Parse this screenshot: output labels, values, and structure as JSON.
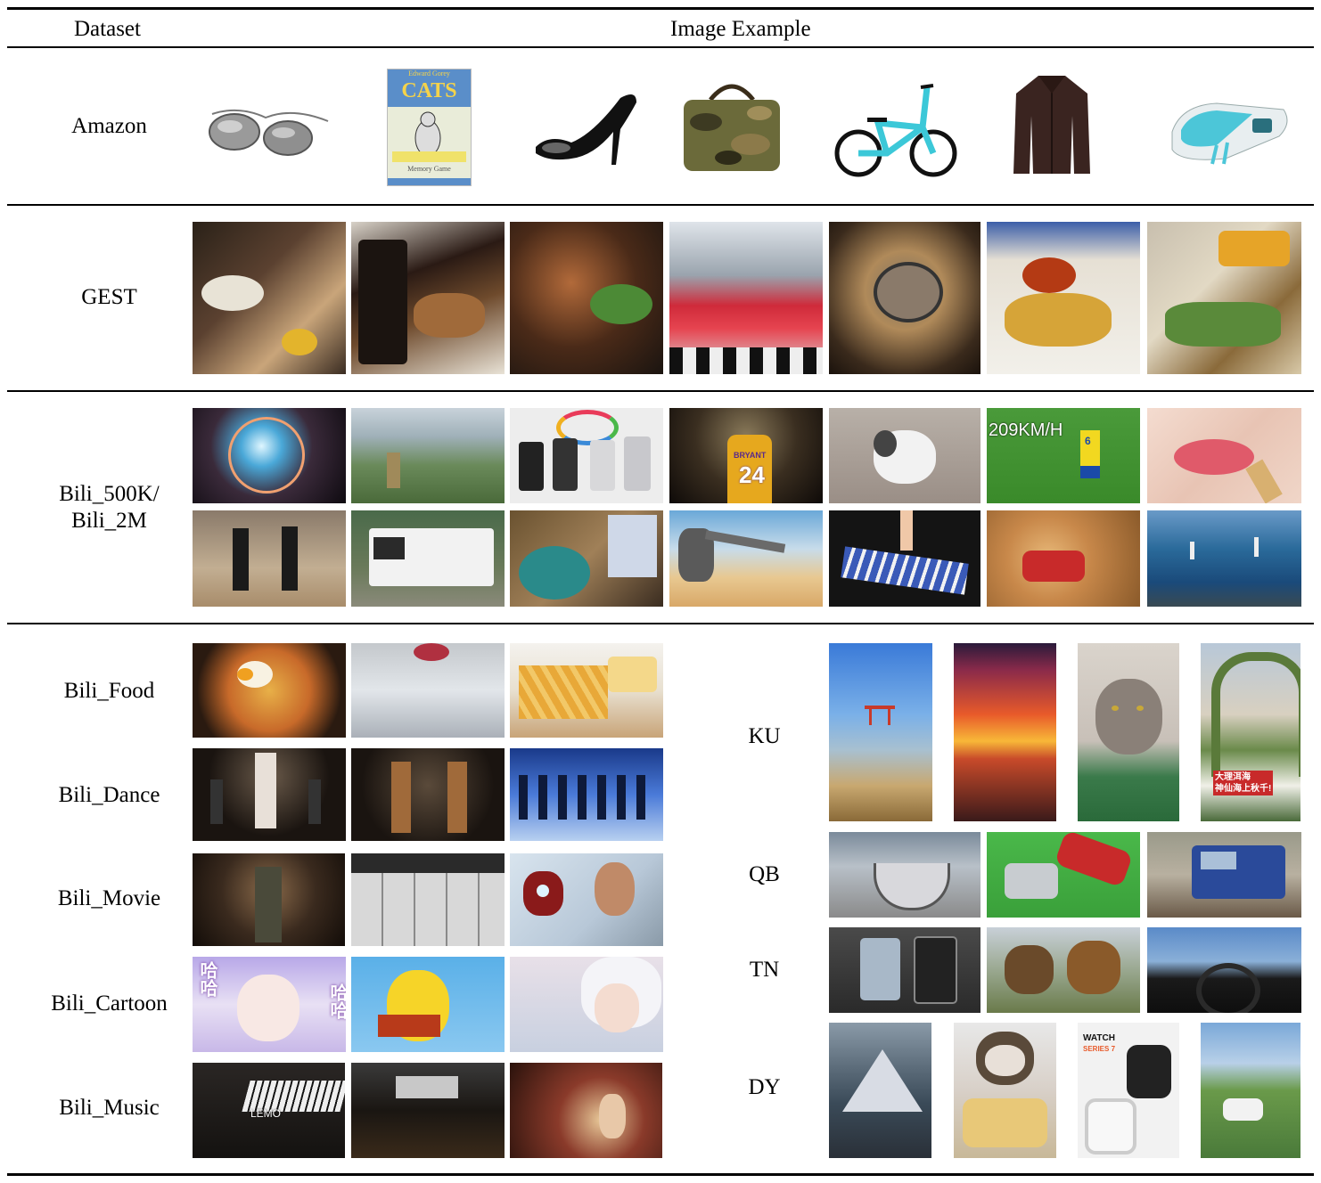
{
  "header": {
    "dataset": "Dataset",
    "image_example": "Image Example"
  },
  "rows": {
    "amazon": "Amazon",
    "gest": "GEST",
    "bili500k_line1": "Bili_500K/",
    "bili500k_line2": "Bili_2M",
    "bili_food": "Bili_Food",
    "bili_dance": "Bili_Dance",
    "bili_movie": "Bili_Movie",
    "bili_cartoon": "Bili_Cartoon",
    "bili_music": "Bili_Music",
    "ku": "KU",
    "qb": "QB",
    "tn": "TN",
    "dy": "DY"
  },
  "amazon_items": {
    "book_top": "Edward Gorey",
    "book_title": "CATS",
    "book_bottom": "Memory Game"
  },
  "overlays": {
    "speed": "209KM/H",
    "jersey_kobe": "24",
    "bryant": "BRYANT",
    "jersey_brazil": "6",
    "ku_chinese": "大理洱海\n神仙海上秋千!",
    "watch_brand": "WATCH",
    "watch_series": "SERIES 7",
    "haha": "哈哈",
    "lemo": "LEMO"
  }
}
